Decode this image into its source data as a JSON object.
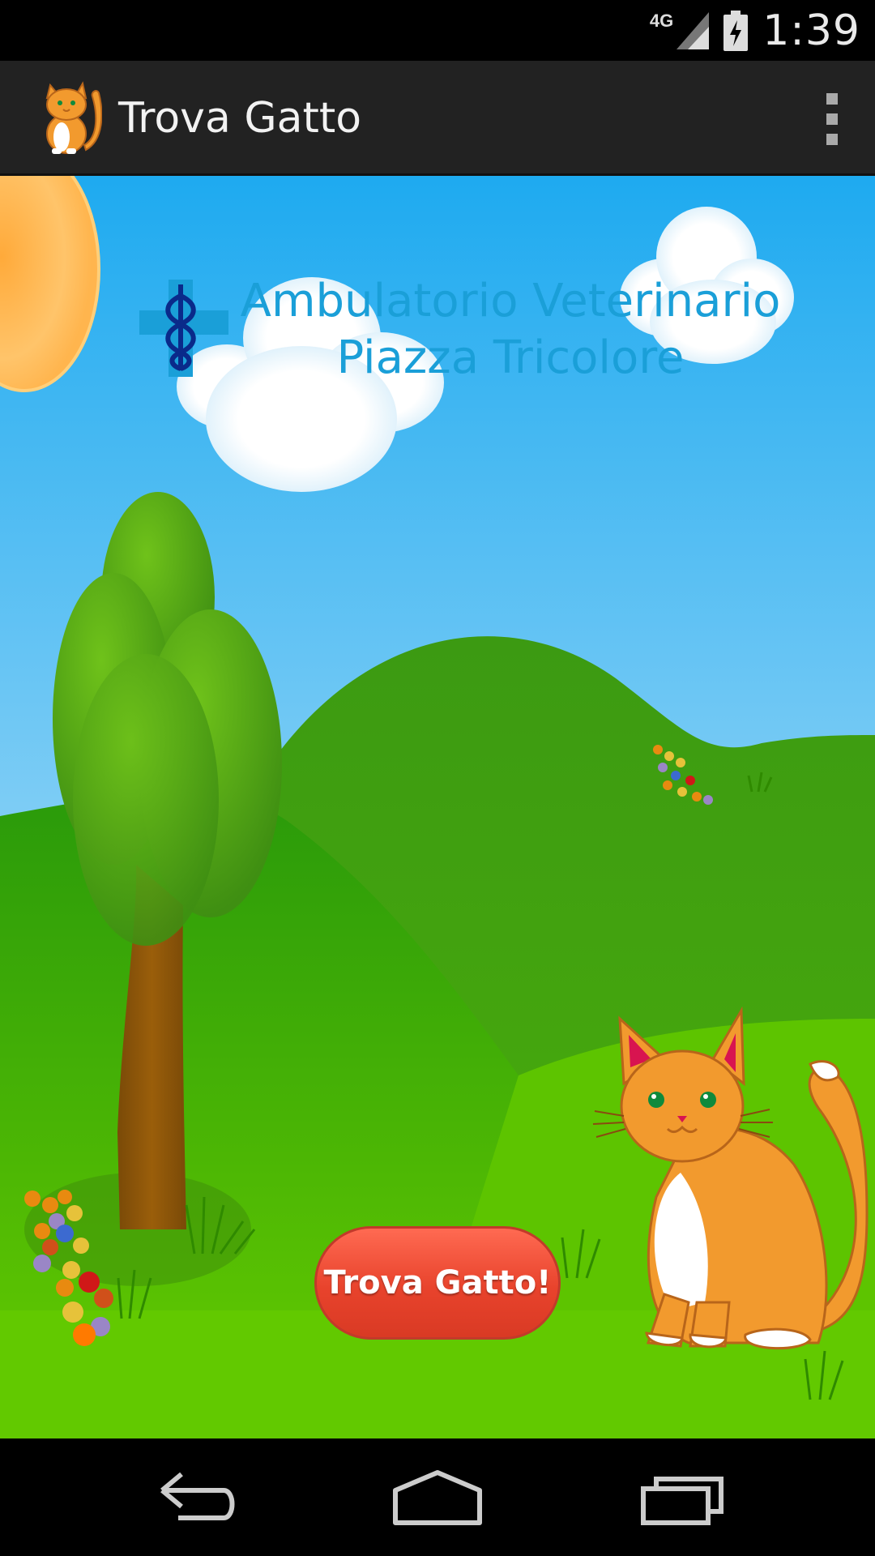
{
  "status_bar": {
    "network_label": "4G",
    "clock": "1:39",
    "icons": [
      "signal-icon",
      "battery-charging-icon"
    ]
  },
  "action_bar": {
    "app_icon": "cat-app-icon",
    "title": "Trova Gatto",
    "menu_icon": "overflow-menu-icon"
  },
  "clinic": {
    "line1": "Ambulatorio Veterinario",
    "line2": "Piazza Tricolore",
    "logo_icon": "caduceus-cross-icon"
  },
  "main": {
    "button_label": "Trova Gatto!"
  },
  "nav_bar": {
    "back_icon": "back-icon",
    "home_icon": "home-icon",
    "recents_icon": "recent-apps-icon"
  },
  "colors": {
    "sky_top": "#1eaaf0",
    "sky_bottom": "#a8dcf5",
    "grass": "#5cc400",
    "button": "#e8432c",
    "clinic_text": "#1a9fd8"
  }
}
